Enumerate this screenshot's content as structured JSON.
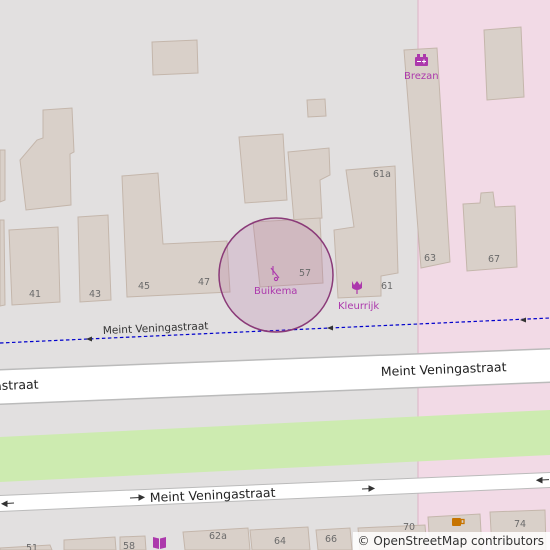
{
  "streets": {
    "main_upper_left": "Meint Veningastraat",
    "main_upper_right": "Meint Veningastraat",
    "footpath": "Meint Veningastraat",
    "service_road": "Meint Veningastraat"
  },
  "pois": {
    "brezan": {
      "name": "Brezan",
      "icon": "battery-icon",
      "color": "#ac39ac"
    },
    "buikema": {
      "name": "Buikema",
      "icon": "hairdresser-icon",
      "color": "#ac39ac"
    },
    "kleurrijk": {
      "name": "Kleurrijk",
      "icon": "florist-icon",
      "color": "#ac39ac"
    },
    "book": {
      "icon": "bookshop-icon",
      "color": "#ac39ac"
    },
    "cafe": {
      "icon": "cafe-icon",
      "color": "#c77400"
    }
  },
  "house_numbers": {
    "n41": "41",
    "n43": "43",
    "n45": "45",
    "n47": "47",
    "n57": "57",
    "n61": "61",
    "n61a": "61a",
    "n63": "63",
    "n67": "67",
    "n51": "51",
    "n58": "58",
    "n62a": "62a",
    "n64": "64",
    "n66": "66",
    "n70": "70",
    "n74": "74"
  },
  "attribution": {
    "symbol": "©",
    "text": "OpenStreetMap contributors"
  },
  "colors": {
    "background": "#e2e0e0",
    "building": "#d9d0c9",
    "building_stroke": "#c4b6ab",
    "grass": "#cdebb0",
    "commercial": "#f2dae6",
    "road": "#ffffff",
    "road_casing": "#bbbbbb",
    "footpath": "#0000cc",
    "highlight": "#b06aa0"
  }
}
